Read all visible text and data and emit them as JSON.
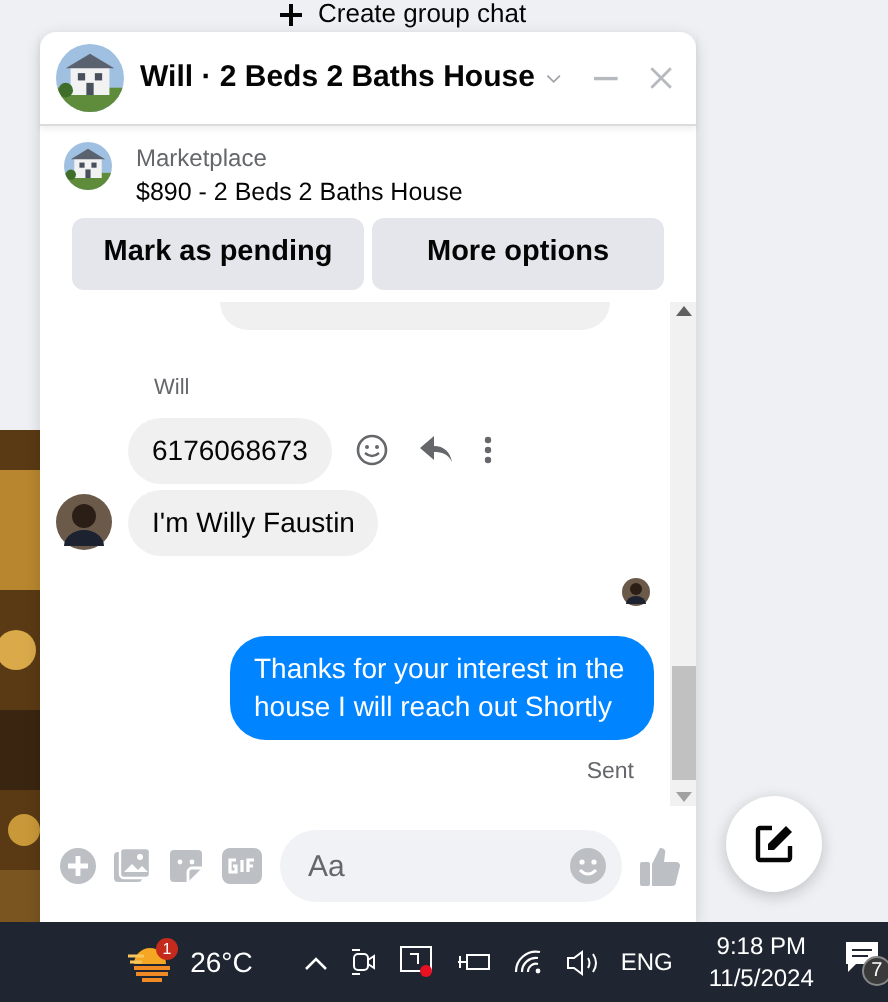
{
  "background": {
    "create_group_chat": "Create group chat"
  },
  "chat": {
    "title": "Will · 2 Beds 2 Baths House",
    "listing": {
      "source": "Marketplace",
      "title": "$890 - 2 Beds 2 Baths House"
    },
    "actions": [
      "Mark as pending",
      "More options"
    ],
    "messages": [
      {
        "kind": "partial"
      },
      {
        "kind": "sender",
        "text": "Will"
      },
      {
        "kind": "incoming",
        "text": "6176068673",
        "hovered": true,
        "avatar": false
      },
      {
        "kind": "incoming",
        "text": "I'm Willy Faustin",
        "hovered": false,
        "avatar": true
      },
      {
        "kind": "seen"
      },
      {
        "kind": "outgoing",
        "text": "Thanks for your interest in the house I will reach out Shortly"
      },
      {
        "kind": "status",
        "text": "Sent"
      }
    ],
    "composer": {
      "placeholder": "Aa"
    }
  },
  "taskbar": {
    "weather_badge": "1",
    "temperature": "26°C",
    "language": "ENG",
    "time": "9:18 PM",
    "date": "11/5/2024",
    "notifications": "7"
  }
}
